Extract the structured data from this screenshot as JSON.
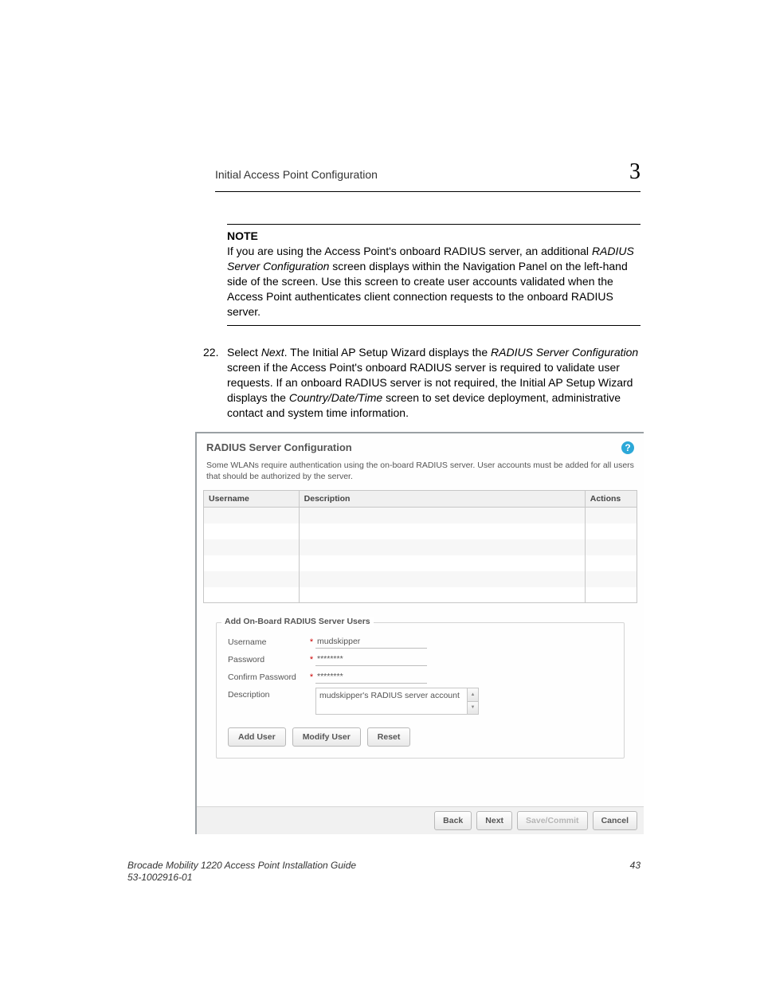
{
  "header": {
    "running_title": "Initial Access Point Configuration",
    "chapter_number": "3"
  },
  "note": {
    "label": "NOTE",
    "text_a": "If you are using the Access Point's onboard RADIUS server, an additional ",
    "text_italic": "RADIUS Server Configuration",
    "text_b": " screen displays within the Navigation Panel on the left-hand side of the screen. Use this screen to create user accounts validated when the Access Point authenticates client connection requests to the onboard RADIUS server."
  },
  "step": {
    "number": "22.",
    "a": "Select ",
    "i1": "Next",
    "b": ". The Initial AP Setup Wizard displays the ",
    "i2": "RADIUS Server Configuration",
    "c": " screen if the Access Point's onboard RADIUS server is required to validate user requests. If an onboard RADIUS server is not required, the Initial AP Setup Wizard displays the ",
    "i3": "Country/Date/Time",
    "d": " screen to set device deployment, administrative contact and system time information."
  },
  "screenshot": {
    "title": "RADIUS Server Configuration",
    "help_glyph": "?",
    "desc": "Some WLANs require authentication using the on-board RADIUS server.  User accounts must be added for all users that should be authorized by the server.",
    "table": {
      "col_username": "Username",
      "col_description": "Description",
      "col_actions": "Actions"
    },
    "fieldset_legend": "Add On-Board RADIUS Server Users",
    "form": {
      "label_username": "Username",
      "value_username": "mudskipper",
      "label_password": "Password",
      "value_password": "********",
      "label_confirm": "Confirm Password",
      "value_confirm": "********",
      "label_description": "Description",
      "value_description": "mudskipper's RADIUS server account"
    },
    "buttons": {
      "add_user": "Add User",
      "modify_user": "Modify User",
      "reset": "Reset"
    },
    "wizard": {
      "back": "Back",
      "next": "Next",
      "save_commit": "Save/Commit",
      "cancel": "Cancel"
    }
  },
  "footer": {
    "guide_title": "Brocade Mobility 1220 Access Point Installation Guide",
    "doc_number": "53-1002916-01",
    "page_number": "43"
  }
}
